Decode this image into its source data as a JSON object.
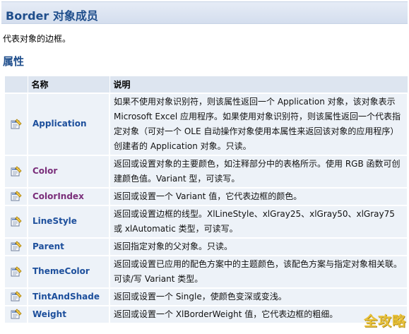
{
  "header": {
    "title": "Border 对象成员"
  },
  "description": "代表对象的边框。",
  "section": {
    "title": "属性"
  },
  "table": {
    "columns": [
      "名称",
      "说明"
    ],
    "rows": [
      {
        "name": "Application",
        "visited": false,
        "icon": "property-icon",
        "description": "如果不使用对象识别符，则该属性返回一个 Application 对象，该对象表示 Microsoft Excel 应用程序。如果使用对象识别符，则该属性返回一个代表指定对象（可对一个 OLE 自动操作对象使用本属性来返回该对象的应用程序）创建者的 Application 对象。只读。"
      },
      {
        "name": "Color",
        "visited": true,
        "icon": "property-icon",
        "description": "返回或设置对象的主要颜色，如注释部分中的表格所示。使用 RGB 函数可创建颜色值。Variant 型，可读写。"
      },
      {
        "name": "ColorIndex",
        "visited": true,
        "icon": "property-icon",
        "description": "返回或设置一个 Variant 值，它代表边框的颜色。"
      },
      {
        "name": "LineStyle",
        "visited": false,
        "icon": "property-icon",
        "description": "返回或设置边框的线型。XlLineStyle、xlGray25、xlGray50、xlGray75 或 xlAutomatic 类型，可读写。"
      },
      {
        "name": "Parent",
        "visited": false,
        "icon": "property-icon",
        "description": "返回指定对象的父对象。只读。"
      },
      {
        "name": "ThemeColor",
        "visited": false,
        "icon": "property-icon",
        "description": "返回或设置已应用的配色方案中的主题颜色，该配色方案与指定对象相关联。可读/写 Variant 类型。"
      },
      {
        "name": "TintAndShade",
        "visited": false,
        "icon": "property-icon",
        "description": "返回或设置一个 Single，使颜色变深或变浅。"
      },
      {
        "name": "Weight",
        "visited": false,
        "icon": "property-icon",
        "description": "返回或设置一个 XlBorderWeight 值，它代表边框的粗细。"
      }
    ]
  },
  "watermark": "全攻略",
  "colors": {
    "title": "#1f4e8c",
    "link": "#1d4f9c",
    "visited_link": "#7a2e7a",
    "header_bg": "#dde5f0",
    "row_bg": "#edf2f8"
  }
}
